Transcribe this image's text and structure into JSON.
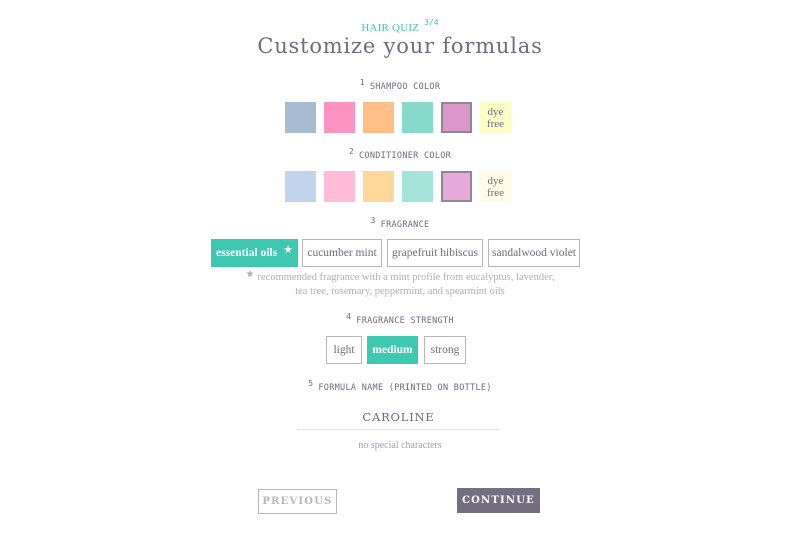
{
  "header": {
    "quiz_label": "HAIR QUIZ",
    "step": "3/4",
    "title": "Customize your formulas"
  },
  "sections": {
    "shampoo": {
      "number": "1",
      "label": "SHAMPOO COLOR",
      "swatches": [
        {
          "name": "blue",
          "color": "#a7bcd1",
          "selected": false
        },
        {
          "name": "pink",
          "color": "#fd93c3",
          "selected": false
        },
        {
          "name": "orange",
          "color": "#ffbf86",
          "selected": false
        },
        {
          "name": "teal",
          "color": "#86d9cb",
          "selected": false
        },
        {
          "name": "purple",
          "color": "#da97ca",
          "selected": true
        },
        {
          "name": "dye-free",
          "color": "#fffdc6",
          "label": "dye free",
          "selected": false
        }
      ]
    },
    "conditioner": {
      "number": "2",
      "label": "CONDITIONER COLOR",
      "swatches": [
        {
          "name": "blue",
          "color": "#c2d4ee",
          "selected": false
        },
        {
          "name": "pink",
          "color": "#ffbcd6",
          "selected": false
        },
        {
          "name": "orange",
          "color": "#ffd799",
          "selected": false
        },
        {
          "name": "teal",
          "color": "#a4e4da",
          "selected": false
        },
        {
          "name": "purple",
          "color": "#e5aada",
          "selected": true
        },
        {
          "name": "dye-free",
          "color": "#fffde8",
          "label": "dye free",
          "selected": false
        }
      ]
    },
    "fragrance": {
      "number": "3",
      "label": "FRAGRANCE",
      "options": [
        {
          "label": "essential oils",
          "selected": true,
          "recommended": true
        },
        {
          "label": "cucumber mint",
          "selected": false
        },
        {
          "label": "grapefruit hibiscus",
          "selected": false
        },
        {
          "label": "sandalwood violet",
          "selected": false
        }
      ],
      "note": "recommended fragrance with a mint profile from eucalyptus, lavender, tea tree, rosemary, peppermint, and spearmint oils"
    },
    "strength": {
      "number": "4",
      "label": "FRAGRANCE STRENGTH",
      "options": [
        {
          "label": "light",
          "selected": false
        },
        {
          "label": "medium",
          "selected": true
        },
        {
          "label": "strong",
          "selected": false
        }
      ]
    },
    "formula_name": {
      "number": "5",
      "label": "FORMULA NAME (PRINTED ON BOTTLE)",
      "value": "CAROLINE",
      "hint": "no special characters"
    }
  },
  "nav": {
    "previous": "PREVIOUS",
    "continue": "CONTINUE"
  },
  "colors": {
    "accent": "#3ec7b1",
    "primary_button": "#736e82",
    "text": "#6e6a7e"
  }
}
